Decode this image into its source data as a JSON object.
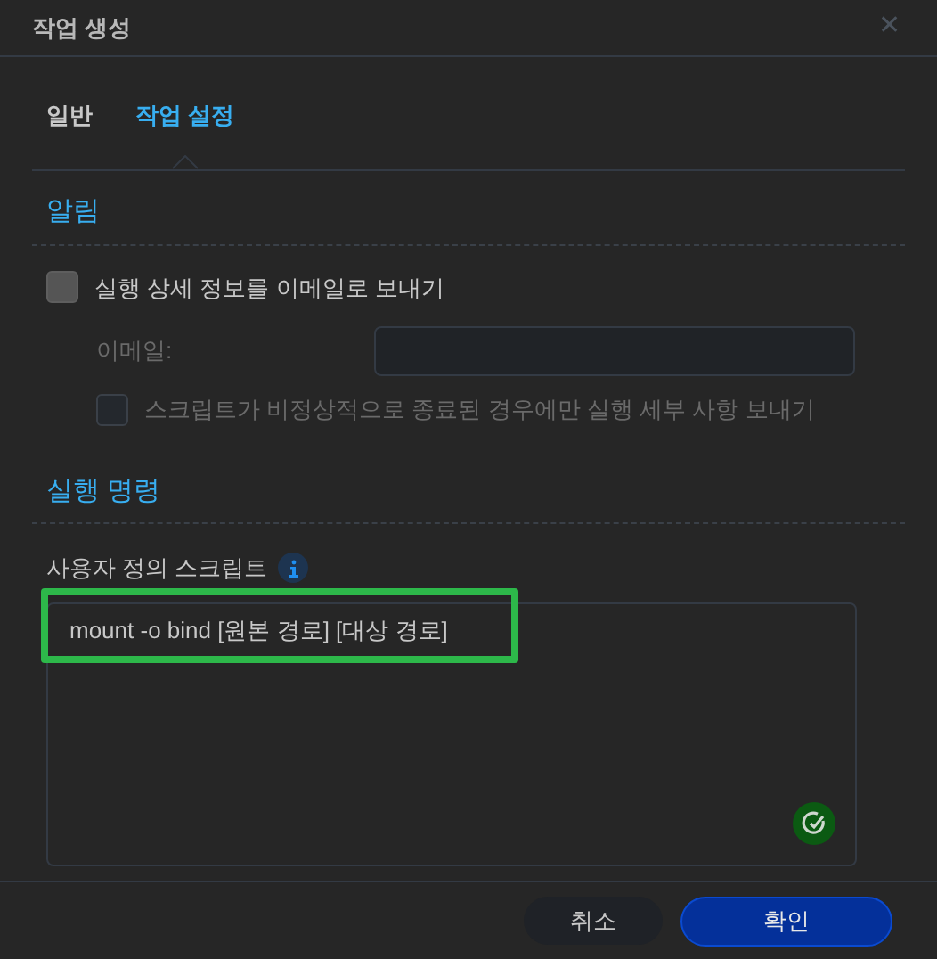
{
  "window": {
    "title": "작업 생성",
    "close": "✕"
  },
  "tabs": [
    {
      "label": "일반",
      "selected": false
    },
    {
      "label": "작업 설정",
      "selected": true
    }
  ],
  "notification": {
    "heading": "알림",
    "send_email": {
      "label": "실행 상세 정보를 이메일로 보내기",
      "checked": false
    },
    "email": {
      "label": "이메일:",
      "disabled": true
    },
    "only_abnormal": {
      "label": "스크립트가 비정상적으로 종료된 경우에만 실행 세부 사항 보내기",
      "checked": false,
      "disabled": true
    }
  },
  "run_command": {
    "heading": "실행 명령",
    "script_label": "사용자 정의 스크립트",
    "script": "mount -o bind [원본 경로] [대상 경로]",
    "highlighted": true
  },
  "buttons": [
    {
      "label": "취소",
      "kind": "secondary"
    },
    {
      "label": "확인",
      "kind": "primary"
    }
  ]
}
